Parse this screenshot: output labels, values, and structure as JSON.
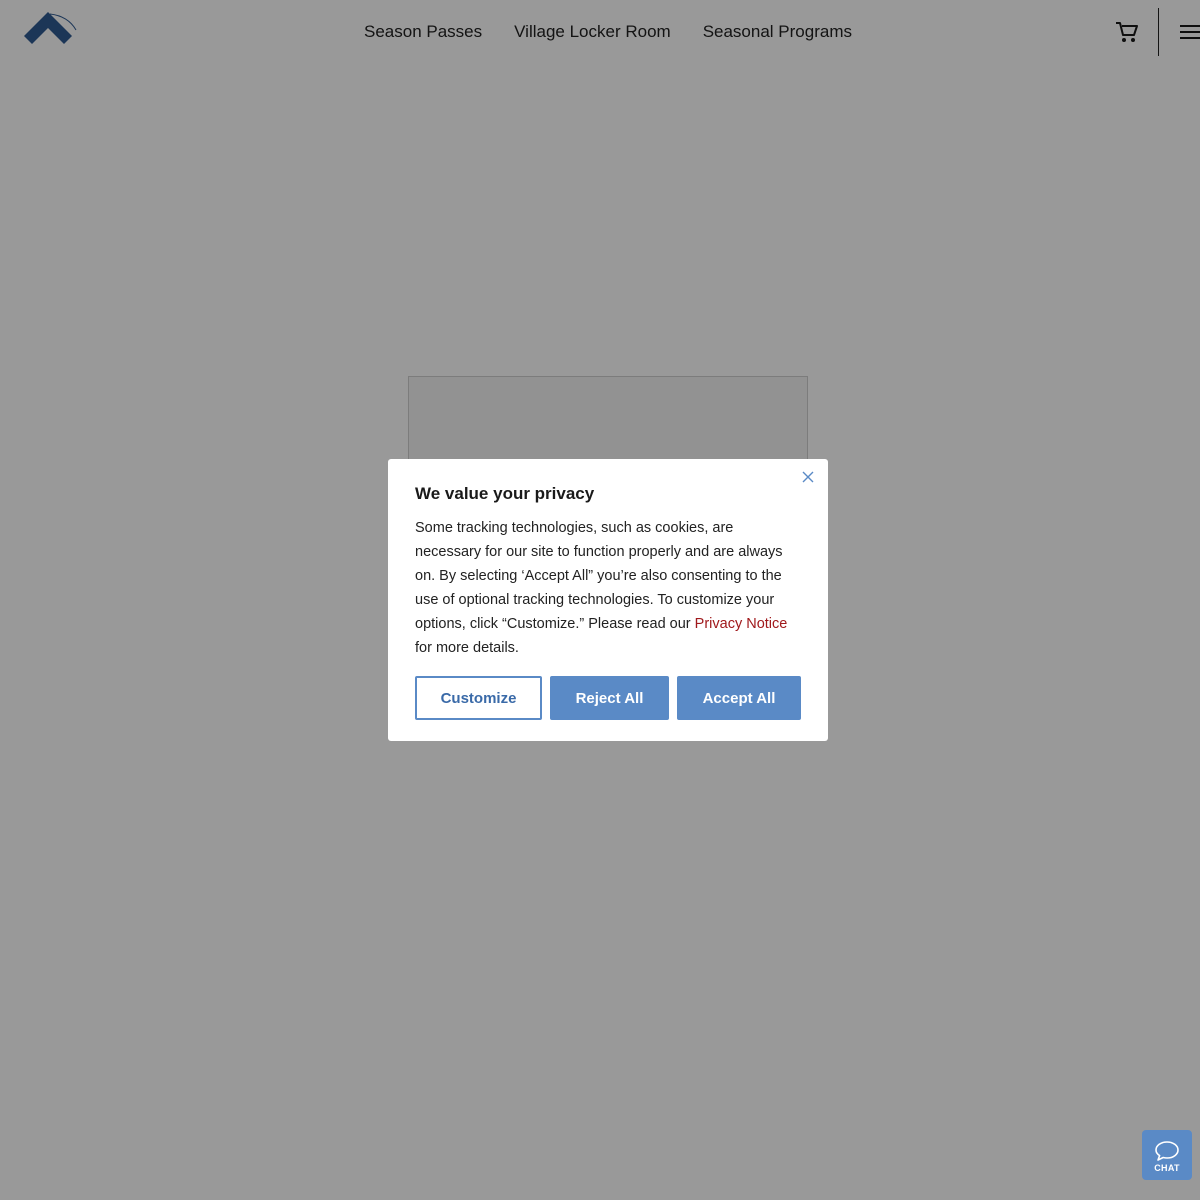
{
  "header": {
    "logo_icon": "mountain-chevron-logo-icon",
    "nav": [
      {
        "label": "Season Passes"
      },
      {
        "label": "Village Locker Room"
      },
      {
        "label": "Seasonal Programs"
      }
    ],
    "cart_icon": "shopping-cart-icon",
    "menu_icon": "hamburger-menu-icon"
  },
  "privacy_dialog": {
    "title": "We value your privacy",
    "body_text": "Some tracking technologies, such as cookies, are necessary for our site to function properly and are always on. By selecting ‘Accept All” you’re also consenting to the use of optional tracking technologies. To customize your options, click “Customize.” Please read our ",
    "link_text": "Privacy Notice",
    "body_suffix": " for more details.",
    "close_icon": "close-icon",
    "buttons": {
      "customize": "Customize",
      "reject": "Reject All",
      "accept": "Accept All"
    }
  },
  "chat": {
    "label": "CHAT",
    "icon": "chat-bubble-icon"
  },
  "colors": {
    "accent": "#5a8ac6",
    "link": "#a0191c",
    "overlay": "rgba(0,0,0,0.4)"
  }
}
